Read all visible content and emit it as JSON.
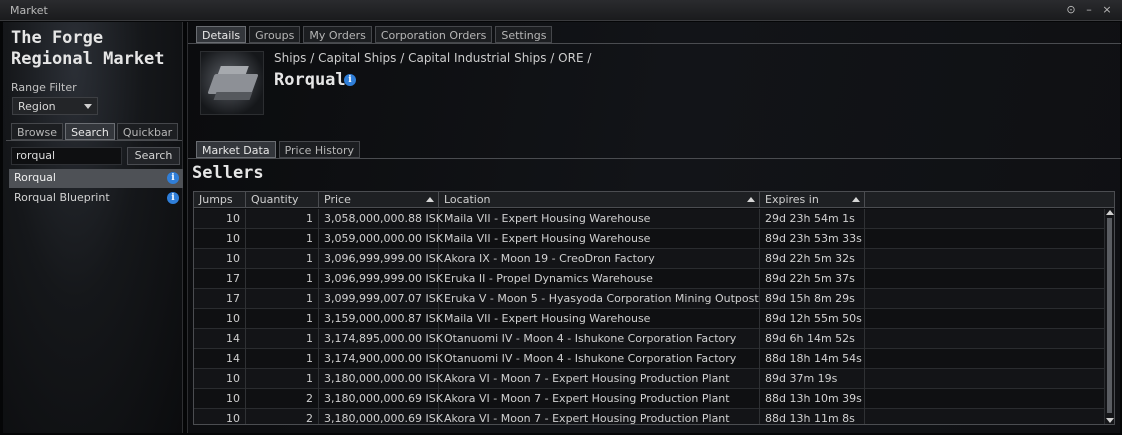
{
  "window": {
    "title": "Market",
    "buttons": [
      "⊙",
      "–",
      "×"
    ]
  },
  "left": {
    "region_title": "The Forge Regional Market",
    "range_filter_label": "Range Filter",
    "range_filter_value": "Region",
    "tabs": [
      "Browse",
      "Search",
      "Quickbar"
    ],
    "search_value": "rorqual",
    "search_button": "Search",
    "results": [
      "Rorqual",
      "Rorqual Blueprint"
    ]
  },
  "right": {
    "tabs": [
      "Details",
      "Groups",
      "My Orders",
      "Corporation Orders",
      "Settings"
    ],
    "breadcrumb": "Ships / Capital Ships / Capital Industrial Ships / ORE /",
    "item_name": "Rorqual",
    "market_tabs": [
      "Market Data",
      "Price History"
    ],
    "section_title": "Sellers",
    "columns": [
      "Jumps",
      "Quantity",
      "Price",
      "Location",
      "Expires in"
    ],
    "rows": [
      [
        "10",
        "1",
        "3,058,000,000.88 ISK",
        "Maila VII - Expert Housing Warehouse",
        "29d 23h 54m 1s"
      ],
      [
        "10",
        "1",
        "3,059,000,000.00 ISK",
        "Maila VII - Expert Housing Warehouse",
        "89d 23h 53m 33s"
      ],
      [
        "10",
        "1",
        "3,096,999,999.00 ISK",
        "Akora IX - Moon 19 - CreoDron Factory",
        "89d 22h 5m 32s"
      ],
      [
        "17",
        "1",
        "3,096,999,999.00 ISK",
        "Eruka II - Propel Dynamics Warehouse",
        "89d 22h 5m 37s"
      ],
      [
        "17",
        "1",
        "3,099,999,007.07 ISK",
        "Eruka V - Moon 5 - Hyasyoda Corporation Mining Outpost",
        "89d 15h 8m 29s"
      ],
      [
        "10",
        "1",
        "3,159,000,000.87 ISK",
        "Maila VII - Expert Housing Warehouse",
        "89d 12h 55m 50s"
      ],
      [
        "14",
        "1",
        "3,174,895,000.00 ISK",
        "Otanuomi IV - Moon 4 - Ishukone Corporation Factory",
        "89d 6h 14m 52s"
      ],
      [
        "14",
        "1",
        "3,174,900,000.00 ISK",
        "Otanuomi IV - Moon 4 - Ishukone Corporation Factory",
        "88d 18h 14m 54s"
      ],
      [
        "10",
        "1",
        "3,180,000,000.00 ISK",
        "Akora VI - Moon 7 - Expert Housing Production Plant",
        "89d 37m 19s"
      ],
      [
        "10",
        "2",
        "3,180,000,000.69 ISK",
        "Akora VI - Moon 7 - Expert Housing Production Plant",
        "88d 13h 10m 39s"
      ],
      [
        "10",
        "2",
        "3,180,000,000.69 ISK",
        "Akora VI - Moon 7 - Expert Housing Production Plant",
        "88d 13h 11m 8s"
      ]
    ]
  }
}
